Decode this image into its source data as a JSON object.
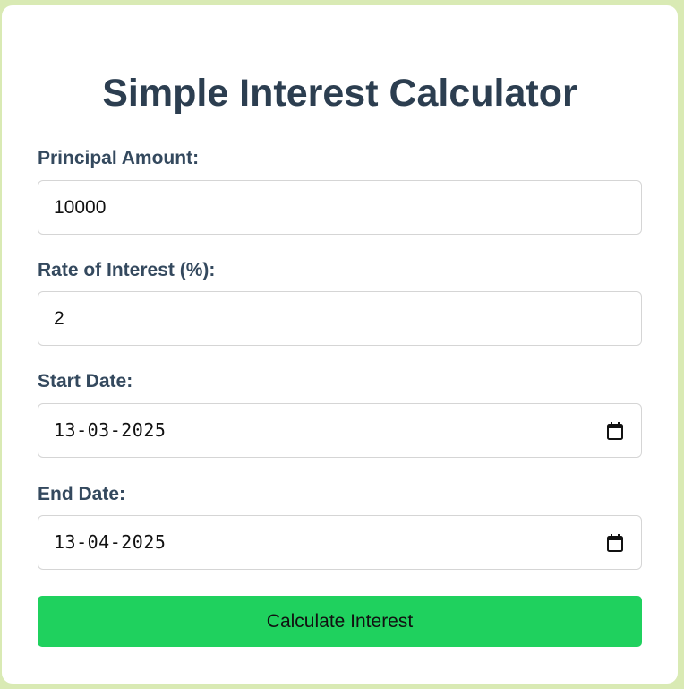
{
  "title": "Simple Interest Calculator",
  "principal": {
    "label": "Principal Amount:",
    "value": "10000"
  },
  "rate": {
    "label": "Rate of Interest (%):",
    "value": "2"
  },
  "start_date": {
    "label": "Start Date:",
    "value": "13-03-2025",
    "icon": "calendar-icon"
  },
  "end_date": {
    "label": "End Date:",
    "value": "13-04-2025",
    "icon": "calendar-icon"
  },
  "button": {
    "label": "Calculate Interest"
  },
  "colors": {
    "page_background": "#d9eab4",
    "card_background": "#ffffff",
    "title": "#2c3e50",
    "label": "#34495e",
    "button": "#1fd15e"
  }
}
